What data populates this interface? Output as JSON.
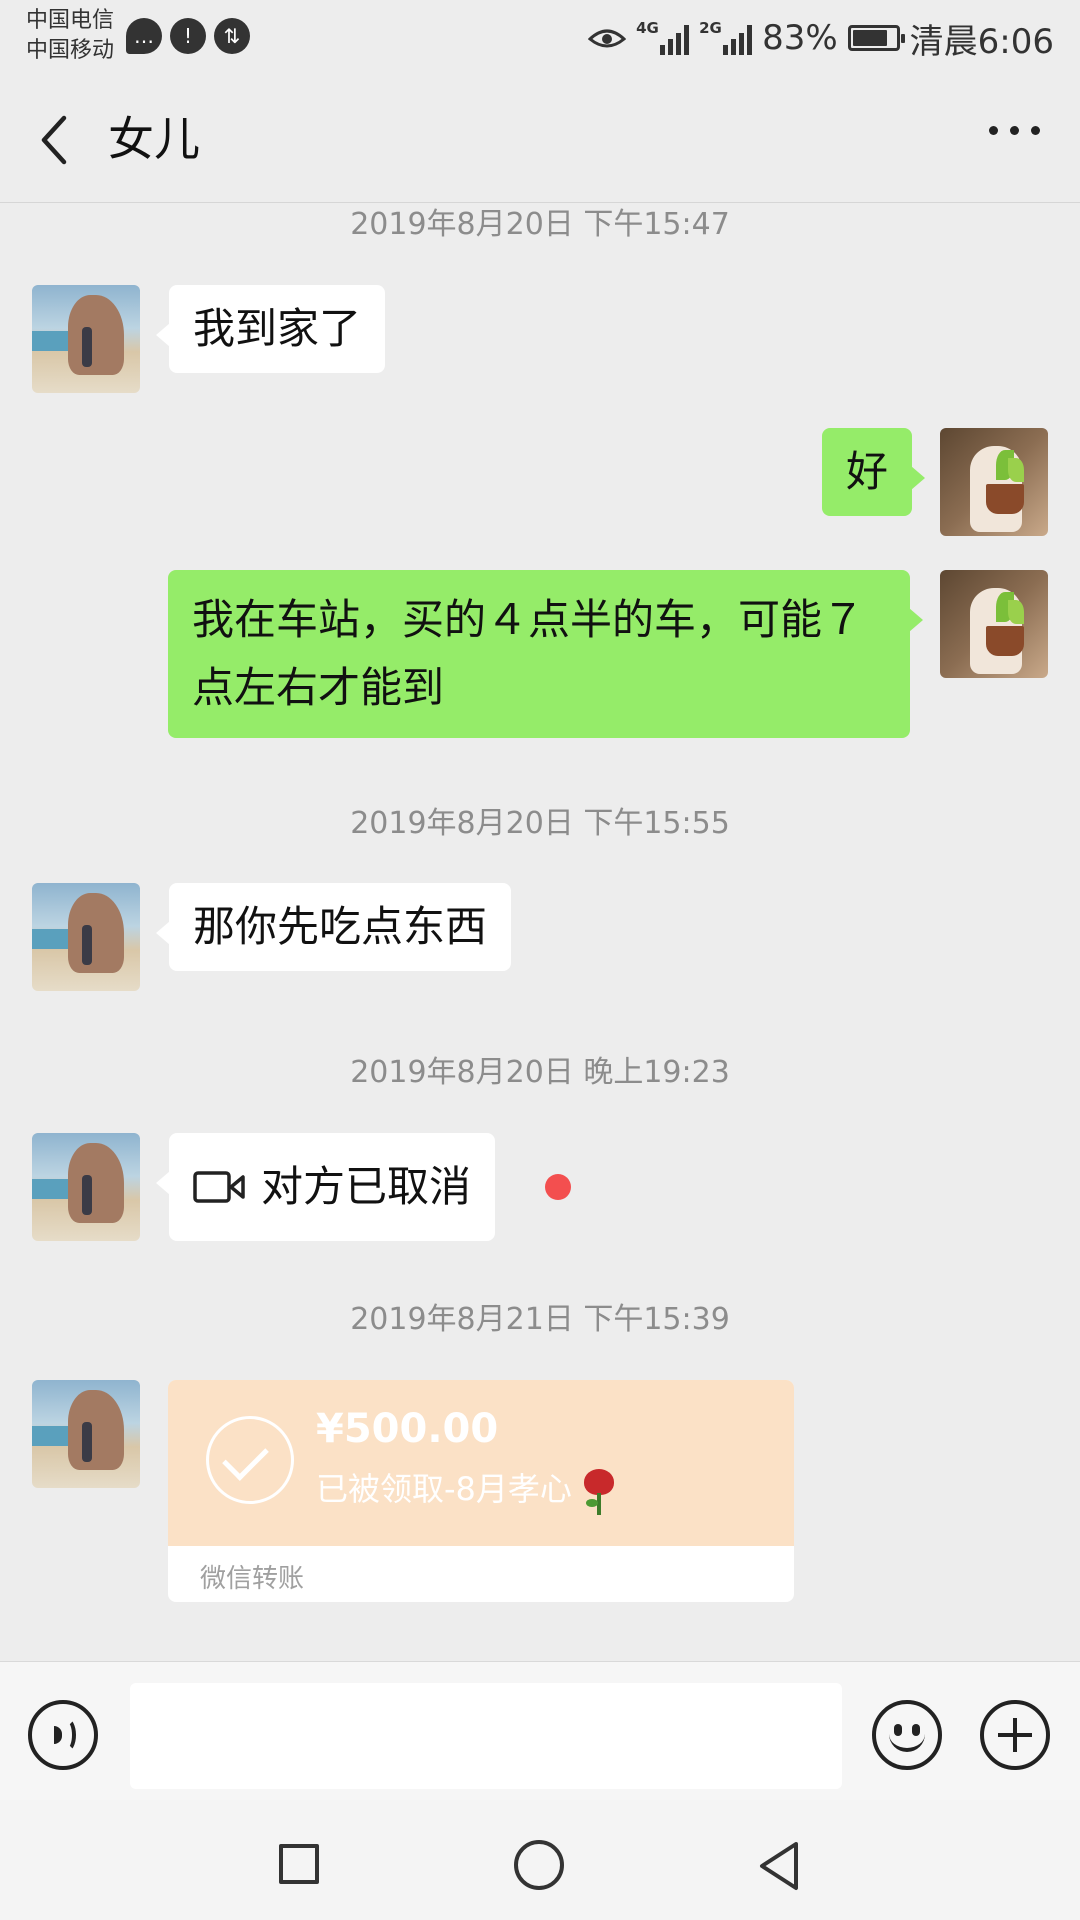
{
  "status_bar": {
    "carrier_1": "中国电信",
    "carrier_2": "中国移动",
    "network_1": "4G",
    "network_2": "2G",
    "battery": "83%",
    "time": "清晨6:06",
    "battery_level": 0.83
  },
  "header": {
    "title": "女儿",
    "back_icon": "chevron-left-icon",
    "more_icon": "more-icon"
  },
  "messages": [
    {
      "type": "timestamp",
      "text": "2019年8月20日 下午15:47"
    },
    {
      "type": "incoming",
      "text": "我到家了"
    },
    {
      "type": "outgoing",
      "text": "好"
    },
    {
      "type": "outgoing",
      "text": "我在车站，买的４点半的车，可能７点左右才能到"
    },
    {
      "type": "timestamp",
      "text": "2019年8月20日 下午15:55"
    },
    {
      "type": "incoming",
      "text": "那你先吃点东西"
    },
    {
      "type": "timestamp",
      "text": "2019年8月20日 晚上19:23"
    },
    {
      "type": "incoming_call",
      "text": "对方已取消",
      "icon": "video-call-icon"
    },
    {
      "type": "timestamp",
      "text": "2019年8月21日 下午15:39"
    },
    {
      "type": "transfer",
      "amount": "¥500.00",
      "note": "已被领取-8月孝心",
      "label": "微信转账",
      "icon": "check-circle-icon"
    }
  ],
  "input_bar": {
    "voice_icon": "voice-icon",
    "emoji_icon": "emoji-icon",
    "plus_icon": "plus-icon",
    "value": ""
  },
  "nav_bar": {
    "icons": [
      "recent-apps-icon",
      "home-icon",
      "back-icon"
    ]
  },
  "colors": {
    "background": "#ededed",
    "outgoing_bubble": "#95ec69",
    "incoming_bubble": "#ffffff",
    "transfer_card": "#fbe1c6",
    "unread_dot": "#f34f4f"
  }
}
